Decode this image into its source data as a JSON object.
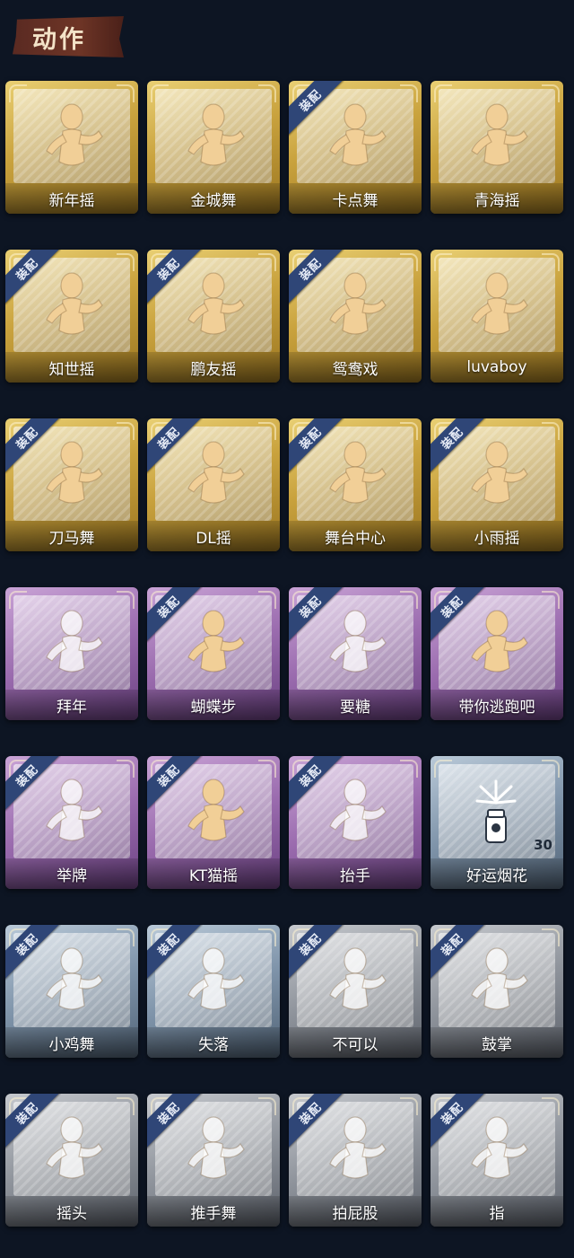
{
  "header": {
    "title": "动作"
  },
  "badge_label": "装配",
  "colors": {
    "gold": "#c9a23d",
    "purple": "#9a6bae",
    "blue": "#7f94aa",
    "gray": "#8e939b",
    "badge": "#2f4677"
  },
  "cards": [
    {
      "name": "新年摇",
      "tier": "gold",
      "equipped": false,
      "icon": "fan-wave-figure-icon"
    },
    {
      "name": "金城舞",
      "tier": "gold",
      "equipped": false,
      "icon": "dance-figure-icon"
    },
    {
      "name": "卡点舞",
      "tier": "gold",
      "equipped": true,
      "icon": "pointing-dance-figure-icon"
    },
    {
      "name": "青海摇",
      "tier": "gold",
      "equipped": false,
      "icon": "arms-cross-figure-icon"
    },
    {
      "name": "知世摇",
      "tier": "gold",
      "equipped": true,
      "icon": "music-sway-figure-icon"
    },
    {
      "name": "鹏友摇",
      "tier": "gold",
      "equipped": true,
      "icon": "arm-wave-figure-icon"
    },
    {
      "name": "鸳鸯戏",
      "tier": "gold",
      "equipped": true,
      "icon": "fist-dance-figure-icon"
    },
    {
      "name": "luvaboy",
      "tier": "gold",
      "equipped": false,
      "icon": "arm-swing-figure-icon"
    },
    {
      "name": "刀马舞",
      "tier": "gold",
      "equipped": true,
      "icon": "sword-dance-figure-icon"
    },
    {
      "name": "DL摇",
      "tier": "gold",
      "equipped": true,
      "icon": "raised-arm-figure-icon"
    },
    {
      "name": "舞台中心",
      "tier": "gold",
      "equipped": true,
      "icon": "center-stage-figure-icon"
    },
    {
      "name": "小雨摇",
      "tier": "gold",
      "equipped": true,
      "icon": "rain-sway-figure-icon"
    },
    {
      "name": "拜年",
      "tier": "purple",
      "equipped": false,
      "icon": "bow-greeting-figure-icon"
    },
    {
      "name": "蝴蝶步",
      "tier": "purple",
      "equipped": true,
      "icon": "butterfly-step-figure-icon"
    },
    {
      "name": "要糖",
      "tier": "purple",
      "equipped": true,
      "icon": "ask-candy-figure-icon"
    },
    {
      "name": "带你逃跑吧",
      "tier": "purple",
      "equipped": true,
      "icon": "run-away-figure-icon"
    },
    {
      "name": "举牌",
      "tier": "purple",
      "equipped": true,
      "icon": "sign-holding-figure-icon"
    },
    {
      "name": "KT猫摇",
      "tier": "purple",
      "equipped": true,
      "icon": "cat-sway-figure-icon"
    },
    {
      "name": "抬手",
      "tier": "purple",
      "equipped": true,
      "icon": "hand-raise-figure-icon"
    },
    {
      "name": "好运烟花",
      "tier": "blue",
      "equipped": false,
      "icon": "firework-can-icon",
      "count": "30"
    },
    {
      "name": "小鸡舞",
      "tier": "blue",
      "equipped": true,
      "icon": "chicken-dance-figure-icon"
    },
    {
      "name": "失落",
      "tier": "blue",
      "equipped": true,
      "icon": "crawling-figure-icon"
    },
    {
      "name": "不可以",
      "tier": "gray",
      "equipped": true,
      "icon": "finger-wag-icon"
    },
    {
      "name": "鼓掌",
      "tier": "gray",
      "equipped": true,
      "icon": "clapping-hands-icon"
    },
    {
      "name": "摇头",
      "tier": "gray",
      "equipped": true,
      "icon": "head-shake-figure-icon"
    },
    {
      "name": "推手舞",
      "tier": "gray",
      "equipped": true,
      "icon": "push-hands-figure-icon"
    },
    {
      "name": "拍屁股",
      "tier": "gray",
      "equipped": true,
      "icon": "butt-pat-figure-icon"
    },
    {
      "name": "指",
      "tier": "gray",
      "equipped": true,
      "icon": "pointing-hand-icon"
    }
  ]
}
